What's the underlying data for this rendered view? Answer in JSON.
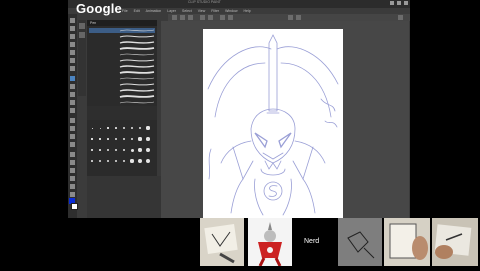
{
  "app": {
    "logo": "Google",
    "title": "CLIP STUDIO PAINT",
    "menus": [
      "File",
      "Edit",
      "Animation",
      "Layer",
      "Select",
      "View",
      "Filter",
      "Window",
      "Help"
    ]
  },
  "brush_panel": {
    "header": "Pen",
    "brushes": [
      "",
      "",
      "",
      "",
      "",
      "",
      "",
      "",
      "",
      "",
      "",
      "",
      ""
    ]
  },
  "video_strip": {
    "participant_label": "Nerd"
  },
  "colors": {
    "main_color": "#0a2bd6",
    "sub_color": "#ffffff",
    "sketch_line": "#9a9fd6"
  }
}
